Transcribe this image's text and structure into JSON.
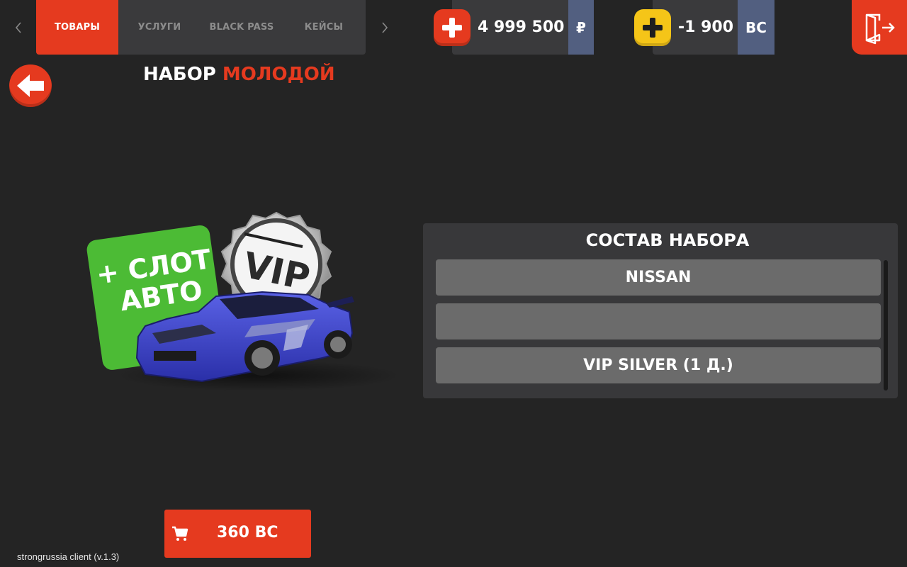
{
  "nav": {
    "tabs": [
      {
        "label": "ТОВАРЫ",
        "active": true
      },
      {
        "label": "УСЛУГИ",
        "active": false
      },
      {
        "label": "BLACK PASS",
        "active": false
      },
      {
        "label": "КЕЙСЫ",
        "active": false
      }
    ],
    "prev_icon": "chevron-left-icon",
    "next_icon": "chevron-right-icon"
  },
  "balance": {
    "rub": {
      "amount": "4 999 500",
      "unit": "₽",
      "add_icon": "plus-icon",
      "add_color": "#e53a1f"
    },
    "bc": {
      "amount": "-1 900",
      "unit": "BC",
      "add_icon": "plus-icon",
      "add_color": "#f5c518"
    }
  },
  "exit_icon": "exit-door-icon",
  "back_icon": "arrow-left-icon",
  "title": {
    "prefix": "НАБОР",
    "accent": "МОЛОДОЙ"
  },
  "product_image": {
    "badge_text_line1": "+ СЛОТ",
    "badge_text_line2": "АВТО",
    "medal_text": "VIP"
  },
  "contents": {
    "title": "СОСТАВ НАБОРА",
    "items": [
      "NISSAN",
      "",
      "VIP SILVER (1 Д.)"
    ]
  },
  "buy": {
    "price": "360 BC",
    "icon": "cart-icon"
  },
  "client_version": "strongrussia client (v.1.3)",
  "colors": {
    "accent": "#e53a1f",
    "background": "#242424",
    "panel": "#38383a",
    "currency_unit": "#525f80",
    "coin": "#f5c518"
  }
}
